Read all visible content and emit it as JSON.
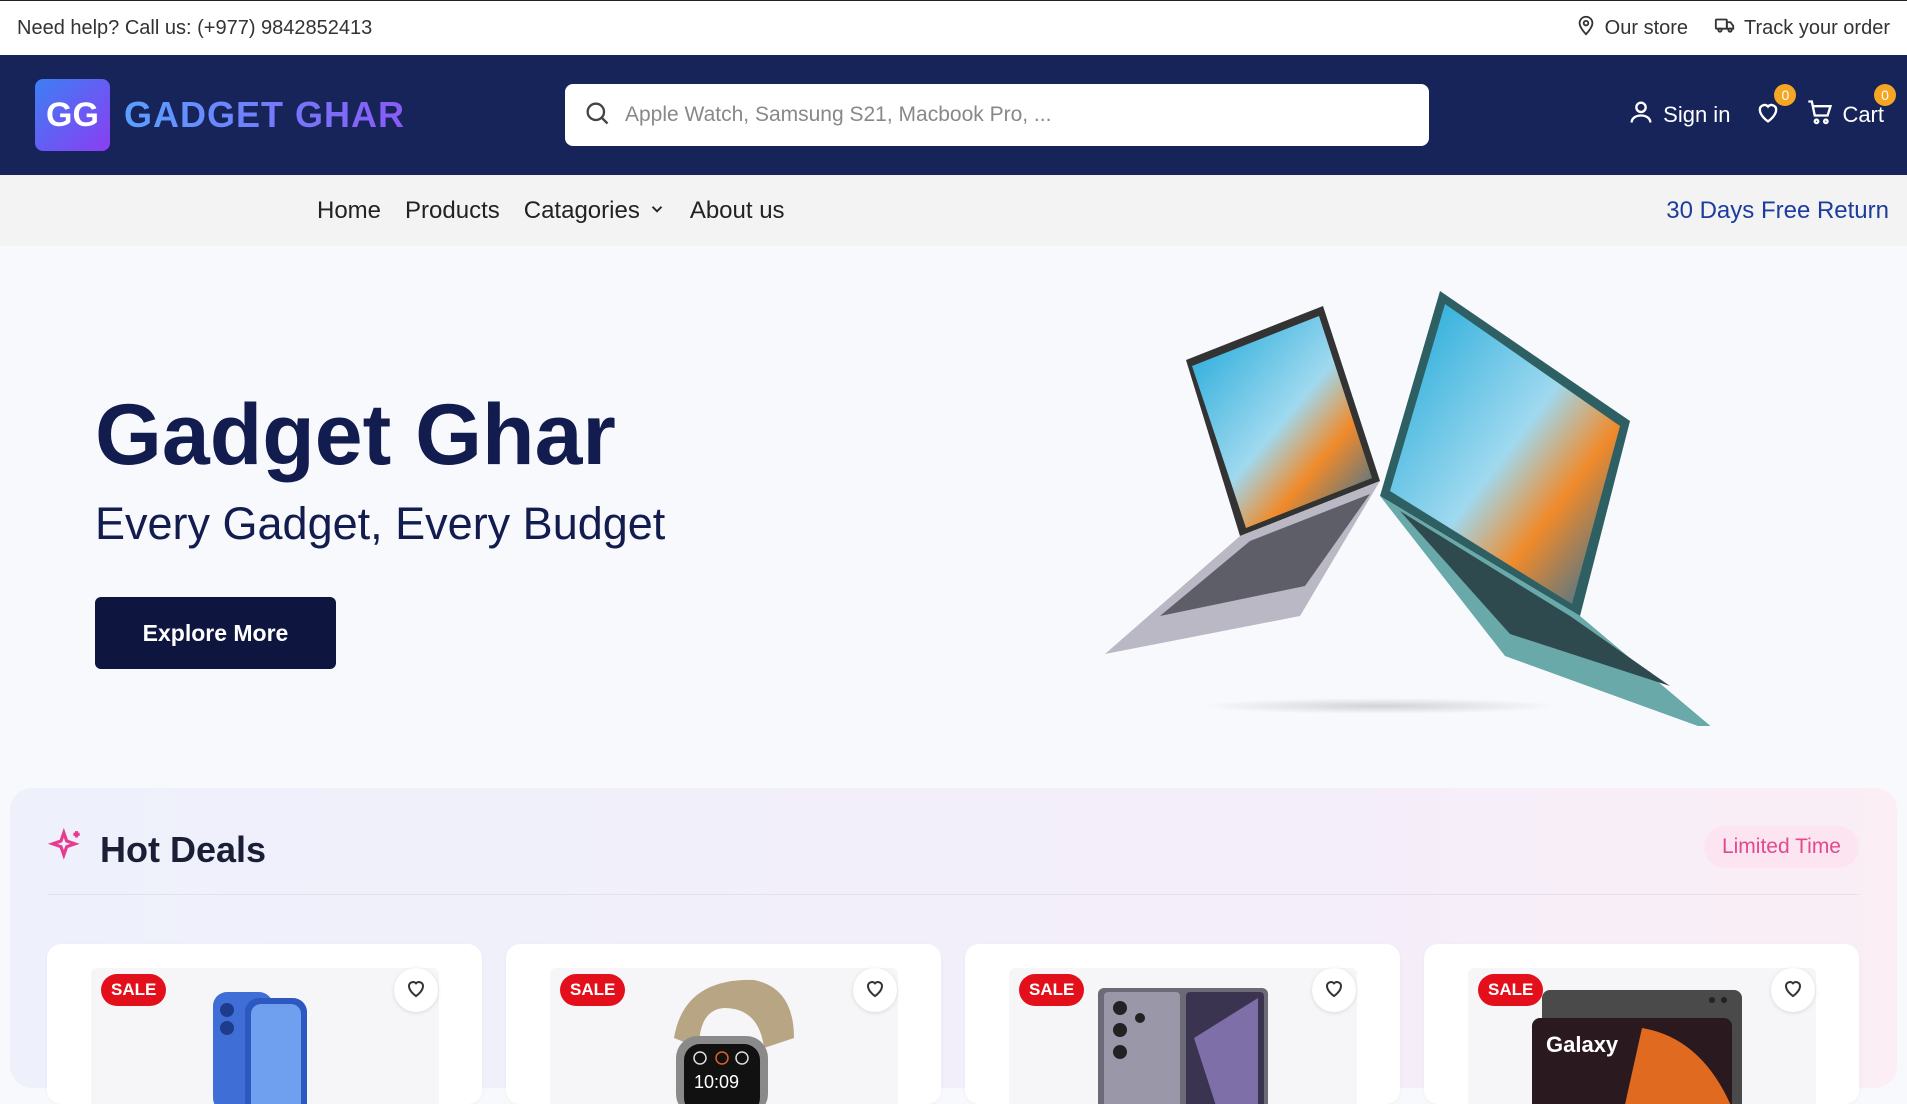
{
  "topbar": {
    "help_text": "Need help? Call us: (+977) 9842852413",
    "store_label": "Our store",
    "track_label": "Track your order"
  },
  "header": {
    "logo_badge": "GG",
    "logo_text": "GADGET GHAR",
    "search_placeholder": "Apple Watch, Samsung S21, Macbook Pro, ...",
    "signin_label": "Sign in",
    "wishlist_count": "0",
    "cart_label": "Cart",
    "cart_count": "0"
  },
  "nav": {
    "items": [
      {
        "label": "Home"
      },
      {
        "label": "Products"
      },
      {
        "label": "Catagories"
      },
      {
        "label": "About us"
      }
    ],
    "promo": "30 Days Free Return"
  },
  "hero": {
    "title": "Gadget Ghar",
    "subtitle": "Every Gadget, Every Budget",
    "cta": "Explore More"
  },
  "deals": {
    "title": "Hot Deals",
    "badge": "Limited Time",
    "cards": [
      {
        "sale": "SALE",
        "product_icon": "phone"
      },
      {
        "sale": "SALE",
        "product_icon": "watch",
        "screen_text": "10:09"
      },
      {
        "sale": "SALE",
        "product_icon": "phone"
      },
      {
        "sale": "SALE",
        "product_icon": "tablet",
        "brand_text": "Galaxy"
      }
    ]
  },
  "colors": {
    "header_bg": "#16245a",
    "accent": "#1d3c9c",
    "cta_bg": "#0e1640",
    "sale_red": "#e3101b",
    "badge_orange": "#f5a623",
    "limited_pink": "#e04a8f"
  }
}
